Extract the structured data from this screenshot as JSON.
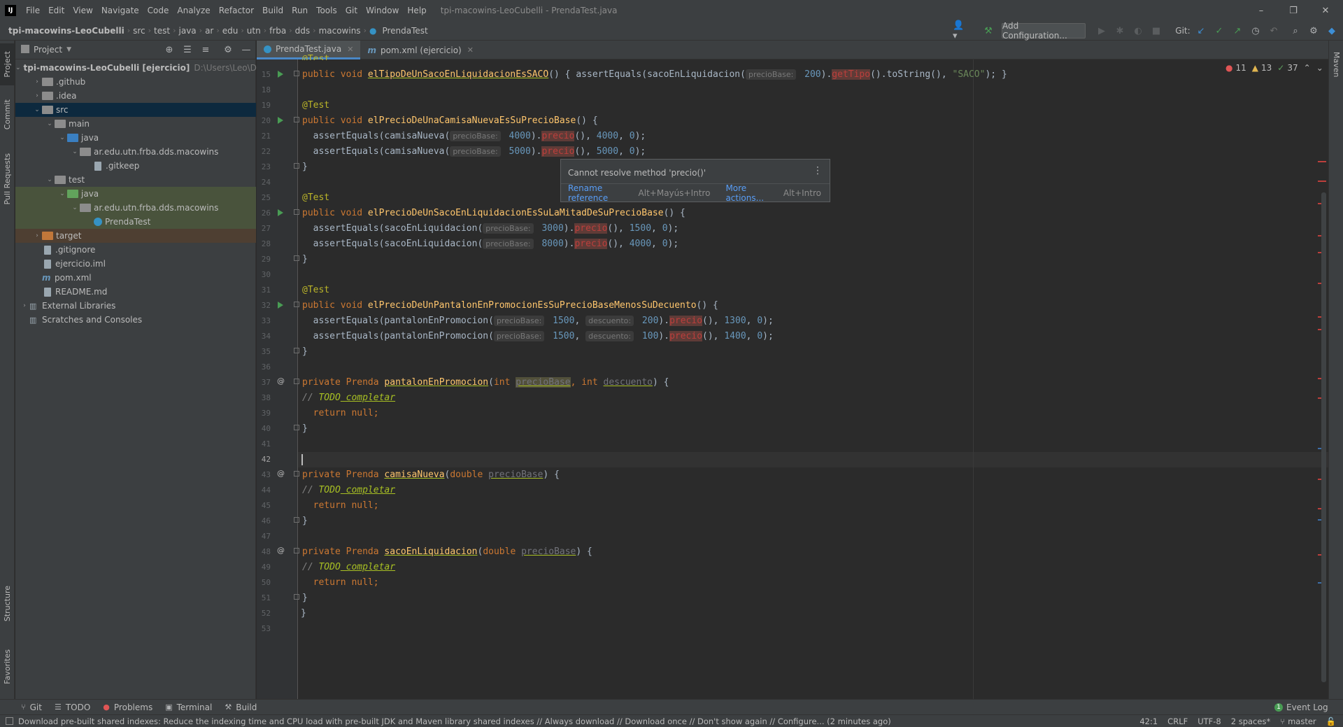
{
  "window": {
    "title": "tpi-macowins-LeoCubelli - PrendaTest.java",
    "menu": [
      "File",
      "Edit",
      "View",
      "Navigate",
      "Code",
      "Analyze",
      "Refactor",
      "Build",
      "Run",
      "Tools",
      "Git",
      "Window",
      "Help"
    ],
    "controls": {
      "minimize": "–",
      "restore": "❐",
      "close": "✕"
    }
  },
  "breadcrumb": [
    "tpi-macowins-LeoCubelli",
    "src",
    "test",
    "java",
    "ar",
    "edu",
    "utn",
    "frba",
    "dds",
    "macowins",
    "PrendaTest"
  ],
  "toolbar": {
    "add_configuration": "Add Configuration...",
    "git_label": "Git:"
  },
  "left_strip": [
    "Project",
    "Commit",
    "Pull Requests",
    "Structure",
    "Favorites"
  ],
  "right_strip": [
    "Maven"
  ],
  "project_panel": {
    "title": "Project",
    "tree": [
      {
        "label": "tpi-macowins-LeoCubelli [ejercicio]",
        "path": "D:\\Users\\Leo\\Deskt",
        "depth": 0,
        "arrow": "open",
        "icon": "folder",
        "style": "bold"
      },
      {
        "label": ".github",
        "depth": 1,
        "arrow": "closed",
        "icon": "folder"
      },
      {
        "label": ".idea",
        "depth": 1,
        "arrow": "closed",
        "icon": "folder"
      },
      {
        "label": "src",
        "depth": 1,
        "arrow": "open",
        "icon": "folder",
        "state": "sel"
      },
      {
        "label": "main",
        "depth": 2,
        "arrow": "open",
        "icon": "folder"
      },
      {
        "label": "java",
        "depth": 3,
        "arrow": "open",
        "icon": "folder-blue"
      },
      {
        "label": "ar.edu.utn.frba.dds.macowins",
        "depth": 4,
        "arrow": "open",
        "icon": "folder"
      },
      {
        "label": ".gitkeep",
        "depth": 5,
        "arrow": "",
        "icon": "file"
      },
      {
        "label": "test",
        "depth": 2,
        "arrow": "open",
        "icon": "folder"
      },
      {
        "label": "java",
        "depth": 3,
        "arrow": "open",
        "icon": "folder-green",
        "state": "hl-test"
      },
      {
        "label": "ar.edu.utn.frba.dds.macowins",
        "depth": 4,
        "arrow": "open",
        "icon": "folder",
        "state": "hl-test"
      },
      {
        "label": "PrendaTest",
        "depth": 5,
        "arrow": "",
        "icon": "class",
        "state": "hl-test"
      },
      {
        "label": "target",
        "depth": 1,
        "arrow": "closed",
        "icon": "folder-orange",
        "state": "hl-target"
      },
      {
        "label": ".gitignore",
        "depth": 1,
        "arrow": "",
        "icon": "file"
      },
      {
        "label": "ejercicio.iml",
        "depth": 1,
        "arrow": "",
        "icon": "file"
      },
      {
        "label": "pom.xml",
        "depth": 1,
        "arrow": "",
        "icon": "maven"
      },
      {
        "label": "README.md",
        "depth": 1,
        "arrow": "",
        "icon": "file"
      },
      {
        "label": "External Libraries",
        "depth": 0,
        "arrow": "closed",
        "icon": "lib"
      },
      {
        "label": "Scratches and Consoles",
        "depth": 0,
        "arrow": "",
        "icon": "lib"
      }
    ]
  },
  "editor": {
    "tabs": [
      {
        "label": "PrendaTest.java",
        "active": true,
        "icon": "class"
      },
      {
        "label": "pom.xml (ejercicio)",
        "active": false,
        "icon": "maven"
      }
    ],
    "inspections": {
      "errors": "11",
      "warnings": "13",
      "ok": "37"
    },
    "line_numbers": [
      "15",
      "18",
      "19",
      "20",
      "21",
      "22",
      "23",
      "24",
      "25",
      "26",
      "27",
      "28",
      "29",
      "30",
      "31",
      "32",
      "33",
      "34",
      "35",
      "36",
      "37",
      "38",
      "39",
      "40",
      "41",
      "42",
      "43",
      "44",
      "45",
      "46",
      "47",
      "48",
      "49",
      "50",
      "51",
      "52",
      "53"
    ],
    "code": {
      "l14_partial": "@Test",
      "l15": {
        "pre": "public void ",
        "fn": "elTipoDeUnSacoEnLiquidacionEsSACO",
        "mid": "() { assertEquals(sacoEnLiquidacion(",
        "hint": "precioBase:",
        "num": " 200",
        "post1": ").",
        "err": "getTipo",
        "post2": "().toString(), ",
        "str": "\"SACO\"",
        "end": "); }"
      },
      "test_ann": "@Test",
      "l20": {
        "fn": "elPrecioDeUnaCamisaNuevaEsSuPrecioBase"
      },
      "l21": {
        "call": "  assertEquals(camisaNueva(",
        "hint": "precioBase:",
        "num": " 4000",
        "err": "precio",
        "rest": "(), ",
        "n2": "4000",
        "n3": "0"
      },
      "l22": {
        "call": "  assertEquals(camisaNueva(",
        "hint": "precioBase:",
        "num": " 5000",
        "err": "precio",
        "rest": "(), ",
        "n2": "5000",
        "n3": "0"
      },
      "l26": {
        "fn": "elPrecioDeUnSacoEnLiquidacionEsSuLaMitadDeSuPrecioBase"
      },
      "l27": {
        "call": "  assertEquals(sacoEnLiquidacion(",
        "hint": "precioBase:",
        "num": " 3000",
        "err": "precio",
        "rest": "(), ",
        "n2": "1500",
        "n3": "0"
      },
      "l28": {
        "call": "  assertEquals(sacoEnLiquidacion(",
        "hint": "precioBase:",
        "num": " 8000",
        "err": "precio",
        "rest": "(), ",
        "n2": "4000",
        "n3": "0"
      },
      "l32": {
        "fn": "elPrecioDeUnPantalonEnPromocionEsSuPrecioBaseMenosSuDecuento"
      },
      "l33": {
        "call": "  assertEquals(pantalonEnPromocion(",
        "hint": "precioBase:",
        "num": " 1500",
        "hint2": "descuento:",
        "num2": " 200",
        "err": "precio",
        "rest": "(), ",
        "n2": "1300",
        "n3": "0"
      },
      "l34": {
        "call": "  assertEquals(pantalonEnPromocion(",
        "hint": "precioBase:",
        "num": " 1500",
        "hint2": "descuento:",
        "num2": " 100",
        "err": "precio",
        "rest": "(), ",
        "n2": "1400",
        "n3": "0"
      },
      "l37": {
        "fn": "pantalonEnPromocion",
        "p1": "precioBase",
        "p2": "descuento"
      },
      "l43": {
        "fn": "camisaNueva",
        "p1": "precioBase"
      },
      "l48": {
        "fn": "sacoEnLiquidacion",
        "p1": "precioBase"
      },
      "todo_comment": "// ",
      "todo_word": "TODO",
      "todo_rest": " completar",
      "return_null": "  return null;",
      "close_brace": "}",
      "class_close": "}"
    }
  },
  "tooltip": {
    "message": "Cannot resolve method 'precio()'",
    "rename": "Rename reference",
    "rename_shortcut": "Alt+Mayús+Intro",
    "more": "More actions...",
    "more_shortcut": "Alt+Intro"
  },
  "bottom_tabs": [
    "Git",
    "TODO",
    "Problems",
    "Terminal",
    "Build"
  ],
  "event_log": "Event Log",
  "event_log_count": "1",
  "status": {
    "message": "Download pre-built shared indexes: Reduce the indexing time and CPU load with pre-built JDK and Maven library shared indexes // Always download // Download once // Don't show again // Configure... (2 minutes ago)",
    "position": "42:1",
    "line_sep": "CRLF",
    "encoding": "UTF-8",
    "indent": "2 spaces*",
    "branch": "master"
  }
}
